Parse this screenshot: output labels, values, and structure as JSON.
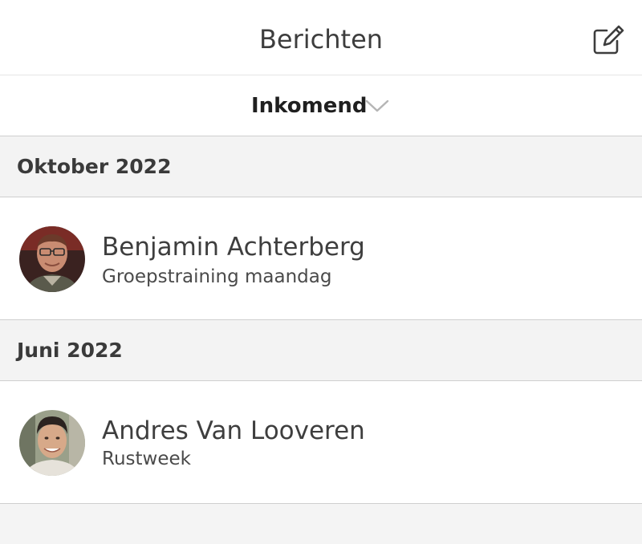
{
  "header": {
    "title": "Berichten",
    "compose_icon": "compose-edit-icon"
  },
  "filter": {
    "label": "Inkomend",
    "chevron_icon": "chevron-down-icon"
  },
  "sections": [
    {
      "label": "Oktober 2022",
      "messages": [
        {
          "sender": "Benjamin Achterberg",
          "subject": "Groepstraining maandag"
        }
      ]
    },
    {
      "label": "Juni 2022",
      "messages": [
        {
          "sender": "Andres Van Looveren",
          "subject": "Rustweek"
        }
      ]
    }
  ],
  "colors": {
    "background": "#f4f4f4",
    "card": "#ffffff",
    "divider": "#cfcfcf",
    "text": "#3e3e3e",
    "chevron": "#b5b5b5"
  }
}
